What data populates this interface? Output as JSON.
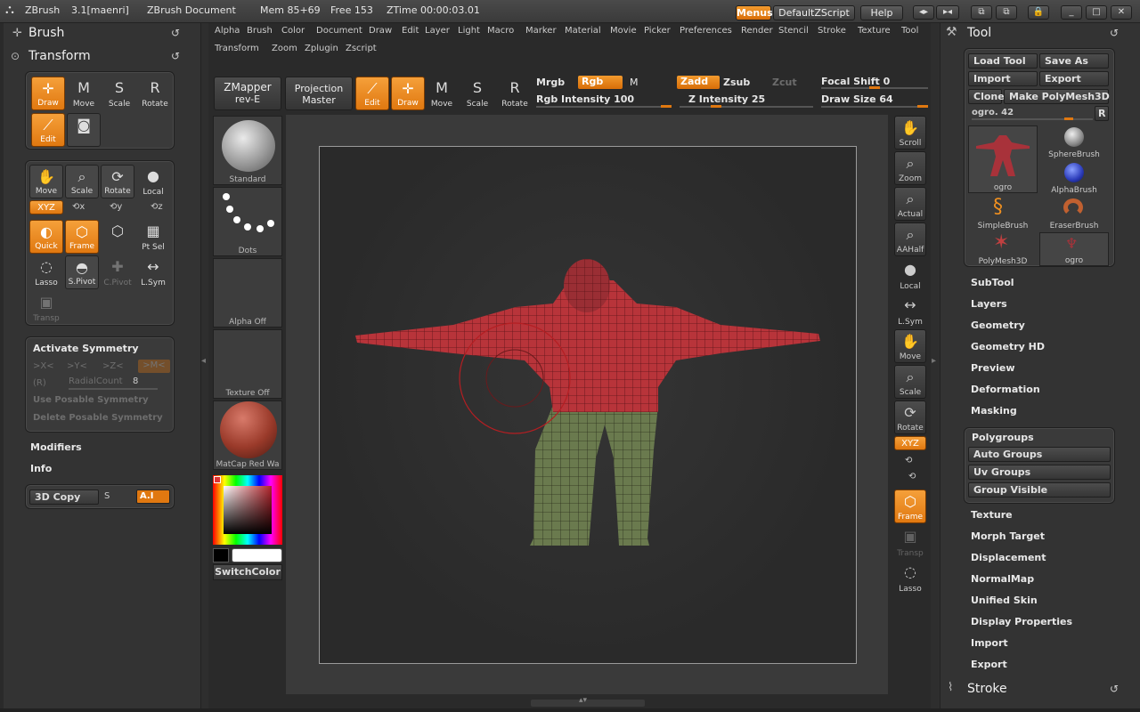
{
  "titlebar": {
    "app": "ZBrush",
    "version": "3.1[maenri]",
    "document": "ZBrush Document",
    "mem": "Mem 85+69",
    "free": "Free 153",
    "ztime": "ZTime 00:00:03.01",
    "menus_btn": "Menus",
    "script_btn": "DefaultZScript",
    "help_btn": "Help"
  },
  "menus": {
    "row1": [
      "Alpha",
      "Brush",
      "Color",
      "Document",
      "Draw",
      "Edit",
      "Layer",
      "Light",
      "Macro",
      "Marker",
      "Material",
      "Movie",
      "Picker",
      "Preferences",
      "Render",
      "Stencil",
      "Stroke",
      "Texture",
      "Tool"
    ],
    "row2": [
      "Transform",
      "Zoom",
      "Zplugin",
      "Zscript"
    ]
  },
  "left": {
    "brush_title": "Brush",
    "transform_title": "Transform",
    "draw_modes": [
      "Draw",
      "Move",
      "Scale",
      "Rotate"
    ],
    "edit": "Edit",
    "nav": [
      "Move",
      "Scale",
      "Rotate",
      "Local"
    ],
    "xyz": "XYZ",
    "quick": "Quick",
    "frame": "Frame",
    "ptsel": "Pt Sel",
    "lasso": "Lasso",
    "spivot": "S.Pivot",
    "cpivot": "C.Pivot",
    "lsym": "L.Sym",
    "transp": "Transp",
    "symmetry": {
      "title": "Activate Symmetry",
      "x": ">X<",
      "y": ">Y<",
      "z": ">Z<",
      "m": ">M<",
      "r": "(R)",
      "radial_label": "RadialCount",
      "radial_value": "8",
      "use_posable": "Use Posable Symmetry",
      "delete_posable": "Delete Posable Symmetry"
    },
    "modifiers": "Modifiers",
    "info": "Info",
    "copy3d": "3D Copy",
    "s": "S",
    "ai": "A.I"
  },
  "shelf": {
    "zmapper_1": "ZMapper",
    "zmapper_2": "rev-E",
    "projection_1": "Projection",
    "projection_2": "Master",
    "modes": [
      "Edit",
      "Draw",
      "Move",
      "Scale",
      "Rotate"
    ],
    "mrgb": "Mrgb",
    "rgb": "Rgb",
    "m": "M",
    "zadd": "Zadd",
    "zsub": "Zsub",
    "zcut": "Zcut",
    "rgb_intensity": "Rgb Intensity 100",
    "z_intensity": "Z Intensity 25",
    "focal_shift": "Focal Shift 0",
    "draw_size": "Draw Size 64",
    "rgb_intensity_value": 100,
    "z_intensity_value": 25,
    "focal_shift_value": 0,
    "draw_size_value": 64
  },
  "sidebarL": {
    "standard": "Standard",
    "dots": "Dots",
    "alpha": "Alpha Off",
    "texture": "Texture Off",
    "material": "MatCap Red Wa",
    "switch": "SwitchColor"
  },
  "rightshelf": [
    "Scroll",
    "Zoom",
    "Actual",
    "AAHalf",
    "Local",
    "L.Sym",
    "Move",
    "Scale",
    "Rotate",
    "XYZ",
    "Frame",
    "Transp",
    "Lasso"
  ],
  "tool": {
    "title": "Tool",
    "load": "Load Tool",
    "saveas": "Save As",
    "import": "Import",
    "export": "Export",
    "clone": "Clone",
    "make_poly": "Make PolyMesh3D",
    "current": "ogro. 42",
    "r": "R",
    "items": [
      "ogro",
      "SphereBrush",
      "AlphaBrush",
      "SimpleBrush",
      "EraserBrush",
      "PolyMesh3D",
      "ogro"
    ],
    "sections": [
      "SubTool",
      "Layers",
      "Geometry",
      "Geometry HD",
      "Preview",
      "Deformation",
      "Masking"
    ],
    "polygroups": "Polygroups",
    "poly_btns": [
      "Auto Groups",
      "Uv Groups",
      "Group Visible"
    ],
    "sections2": [
      "Texture",
      "Morph Target",
      "Displacement",
      "NormalMap",
      "Unified Skin",
      "Display Properties",
      "Import",
      "Export"
    ],
    "stroke": "Stroke"
  },
  "colors": {
    "accent": "#e07810",
    "panel": "#333333",
    "mesh": "#b8343a"
  }
}
